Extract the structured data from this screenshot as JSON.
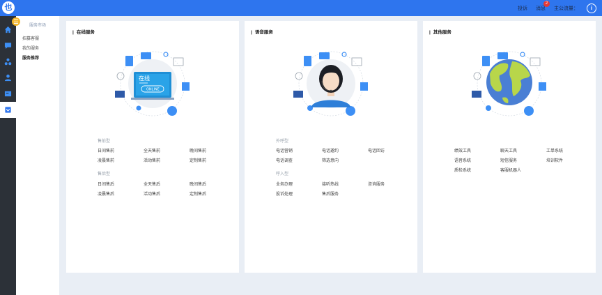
{
  "topbar": {
    "logo": "也",
    "links": [
      "投诉",
      "消息",
      "主公流量："
    ],
    "message_count": "2",
    "user_icon": "i"
  },
  "iconbar": {
    "icons": [
      "home-icon",
      "chat-icon",
      "org-icon",
      "user-icon",
      "card-icon",
      "service-icon"
    ],
    "active_index": 5
  },
  "sidebar": {
    "title": "服务市场",
    "items": [
      "招募客服",
      "我的服务",
      "服务推荐"
    ]
  },
  "cards": [
    {
      "title": "在线服务",
      "screen_text": "在线",
      "screen_button": "ONLINE",
      "categories": [
        {
          "label": "售前型",
          "items": [
            "日间售前",
            "全天售前",
            "晚间售前",
            "凌晨售前",
            "活动售前",
            "定制售前"
          ]
        },
        {
          "label": "售后型",
          "items": [
            "日间售后",
            "全天售后",
            "晚间售后",
            "凌晨售后",
            "活动售后",
            "定制售后"
          ]
        }
      ]
    },
    {
      "title": "语音服务",
      "categories": [
        {
          "label": "外呼型",
          "items": [
            "电话营销",
            "电话邀约",
            "电话回访",
            "电话调查",
            "筛选意向"
          ]
        },
        {
          "label": "呼入型",
          "items": [
            "业务办理",
            "接听热线",
            "咨询服务",
            "投诉处理",
            "售后服务"
          ]
        }
      ]
    },
    {
      "title": "其他服务",
      "categories": [
        {
          "label": "",
          "items": [
            "绩效工具",
            "聊天工具",
            "工单系统",
            "语音系统",
            "短信服务",
            "培训软件",
            "质检系统",
            "客服机器人"
          ]
        }
      ]
    }
  ]
}
